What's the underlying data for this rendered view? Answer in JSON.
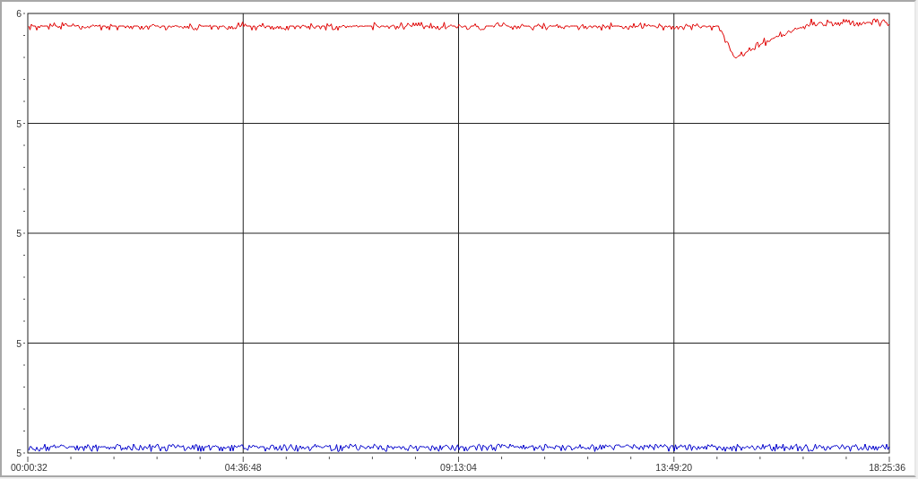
{
  "chart": {
    "y_tick_labels": [
      "6",
      "5",
      "5",
      "5",
      "5"
    ],
    "x_tick_labels": [
      "00:00:32",
      "04:36:48",
      "09:13:04",
      "13:49:20",
      "18:25:36"
    ],
    "series": [
      {
        "color": "#e00000",
        "kind": "upper"
      },
      {
        "color": "#0000cc",
        "kind": "lower"
      }
    ]
  }
}
